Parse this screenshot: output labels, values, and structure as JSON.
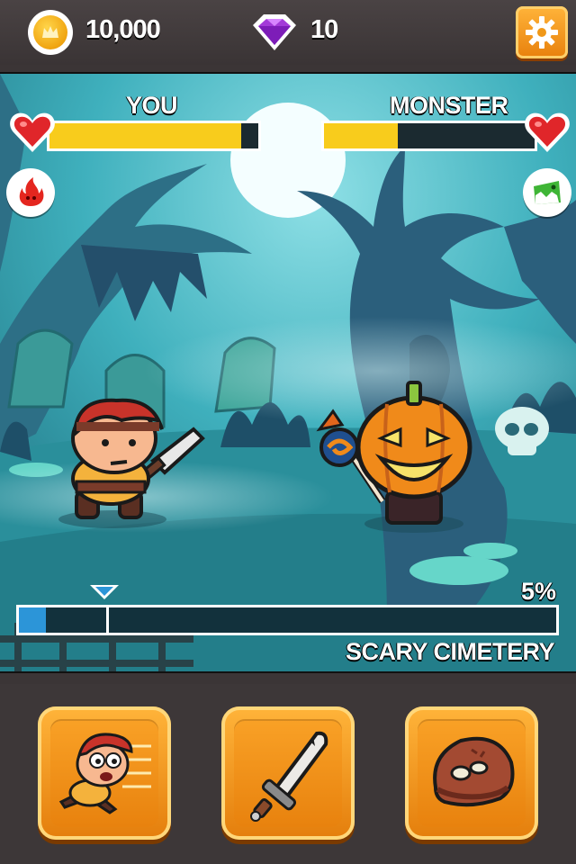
{
  "topbar": {
    "coins": "10,000",
    "gems": "10",
    "coin_icon": "crown-coin-icon",
    "gem_icon": "purple-gem-icon",
    "settings_icon": "gear-icon"
  },
  "battle": {
    "player": {
      "label": "YOU",
      "health_fraction": 0.92,
      "element_icon": "fire-icon"
    },
    "enemy": {
      "label": "MONSTER",
      "health_fraction": 0.35,
      "element_icon": "green-monster-icon"
    },
    "bar_color": "#f8cc1c"
  },
  "level": {
    "progress_text": "5%",
    "progress_fraction": 0.05,
    "name": "SCARY CIMETERY"
  },
  "actions": [
    {
      "name": "flee",
      "icon": "running-hero-icon"
    },
    {
      "name": "attack",
      "icon": "sword-icon"
    },
    {
      "name": "item",
      "icon": "meat-steak-icon"
    }
  ],
  "colors": {
    "accent_orange": "#f39a1c",
    "progress_blue": "#2c95d8",
    "background_dark": "#3b3536"
  }
}
